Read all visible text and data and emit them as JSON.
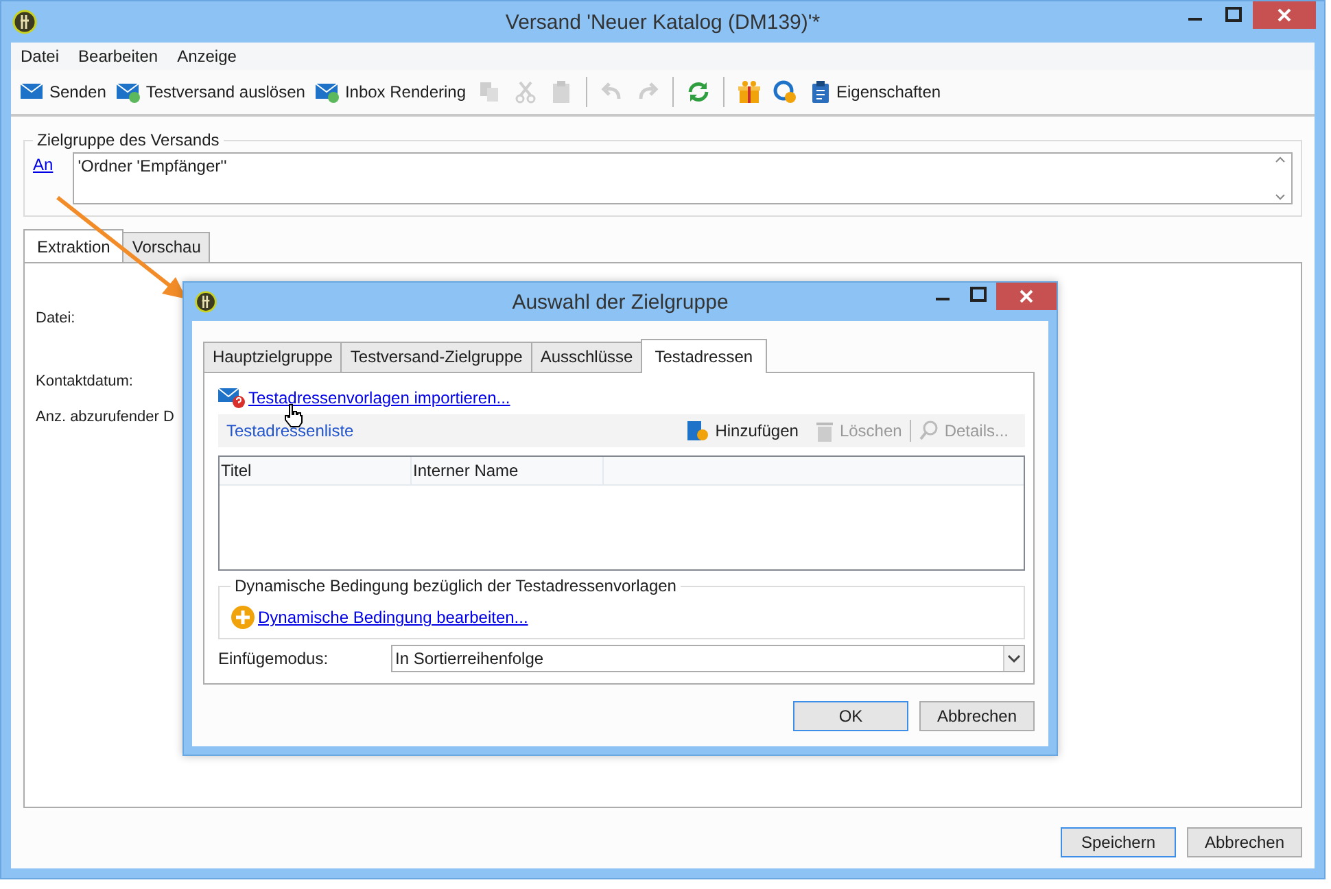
{
  "window": {
    "title": "Versand 'Neuer Katalog (DM139)'*"
  },
  "menu": [
    "Datei",
    "Bearbeiten",
    "Anzeige"
  ],
  "toolbar": [
    {
      "kind": "button",
      "label": "Senden",
      "disabled": false
    },
    {
      "kind": "button",
      "label": "Testversand auslösen",
      "disabled": false
    },
    {
      "kind": "button",
      "label": "Inbox Rendering",
      "disabled": false
    },
    {
      "kind": "icon",
      "disabled": true
    },
    {
      "kind": "icon",
      "disabled": true
    },
    {
      "kind": "icon",
      "disabled": true
    },
    {
      "kind": "separator"
    },
    {
      "kind": "icon",
      "disabled": true
    },
    {
      "kind": "icon",
      "disabled": true
    },
    {
      "kind": "separator"
    },
    {
      "kind": "icon",
      "disabled": false
    },
    {
      "kind": "separator"
    },
    {
      "kind": "icon",
      "disabled": false
    },
    {
      "kind": "icon",
      "disabled": false
    },
    {
      "kind": "button",
      "label": "Eigenschaften",
      "disabled": false
    }
  ],
  "target_group": {
    "legend": "Zielgruppe des Versands",
    "link": "An",
    "value": "'Ordner 'Empfänger''"
  },
  "tabs": [
    {
      "label": "Extraktion",
      "selected": true
    },
    {
      "label": "Vorschau",
      "selected": false
    }
  ],
  "form_labels": [
    "Datei:",
    "Kontaktdatum:",
    "Anz. abzurufender D"
  ],
  "buttons": [
    {
      "label": "Speichern",
      "default": true
    },
    {
      "label": "Abbrechen",
      "default": false
    }
  ],
  "dialog": {
    "title": "Auswahl der Zielgruppe",
    "tabs": [
      {
        "label": "Hauptzielgruppe",
        "selected": false
      },
      {
        "label": "Testversand-Zielgruppe",
        "selected": false
      },
      {
        "label": "Ausschlüsse",
        "selected": false
      },
      {
        "label": "Testadressen",
        "selected": true
      }
    ],
    "import_link": "Testadressenvorlagen importieren...",
    "list_title": "Testadressenliste",
    "list_actions": [
      {
        "label": "Hinzufügen",
        "disabled": false
      },
      {
        "label": "Löschen",
        "disabled": true
      },
      {
        "label": "Details...",
        "disabled": true
      }
    ],
    "columns": [
      "Titel",
      "Interner Name"
    ],
    "condition": {
      "legend": "Dynamische Bedingung bezüglich der Testadressenvorlagen",
      "link": "Dynamische Bedingung bearbeiten..."
    },
    "insert_mode": {
      "label": "Einfügemodus:",
      "value": "In Sortierreihenfolge"
    },
    "buttons": [
      {
        "label": "OK",
        "default": true
      },
      {
        "label": "Abbrechen",
        "default": false
      }
    ]
  }
}
